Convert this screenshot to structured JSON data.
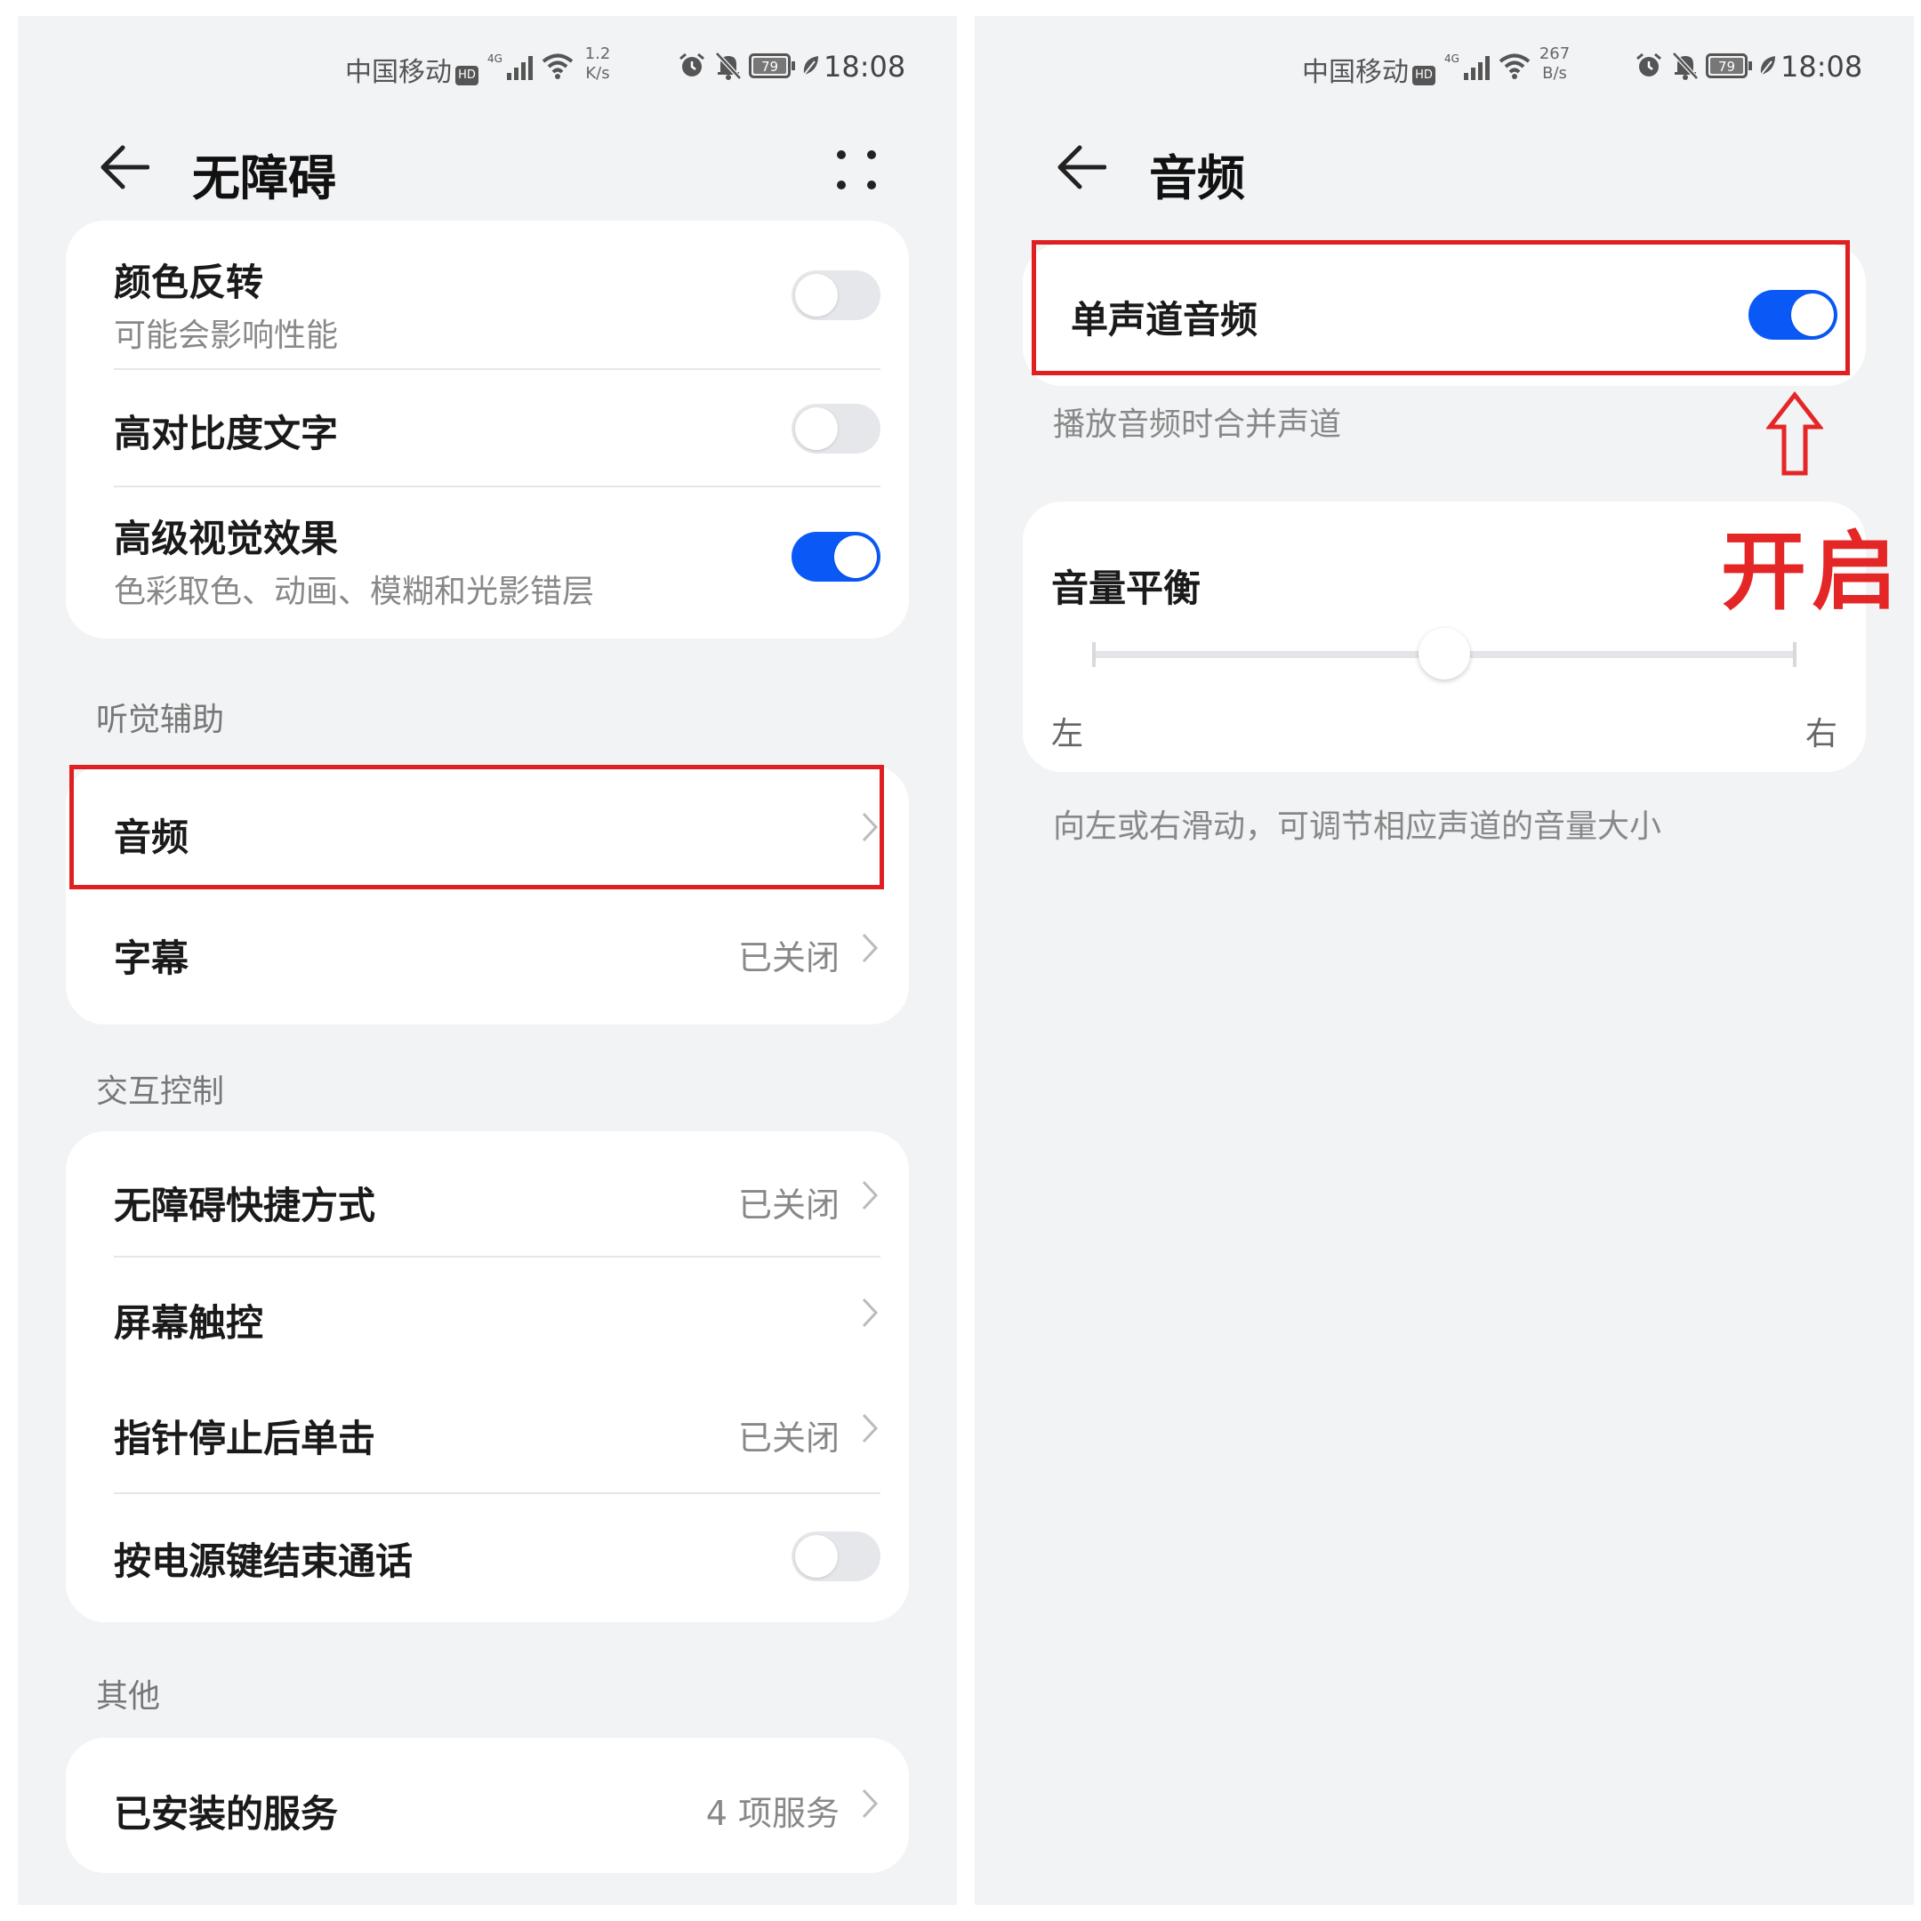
{
  "status_left": {
    "carrier": "中国移动",
    "hd": "HD",
    "net": "4G",
    "speed_top": "1.2",
    "speed_bottom": "K/s",
    "battery": "79",
    "time": "18:08"
  },
  "status_right": {
    "carrier": "中国移动",
    "hd": "HD",
    "net": "4G",
    "speed_top": "267",
    "speed_bottom": "B/s",
    "battery": "79",
    "time": "18:08"
  },
  "left": {
    "title": "无障碍",
    "display_group": [
      {
        "label": "颜色反转",
        "sub": "可能会影响性能",
        "on": false
      },
      {
        "label": "高对比度文字",
        "on": false
      },
      {
        "label": "高级视觉效果",
        "sub": "色彩取色、动画、模糊和光影错层",
        "on": true
      }
    ],
    "hearing_section": "听觉辅助",
    "hearing_items": [
      {
        "label": "音频",
        "value": ""
      },
      {
        "label": "字幕",
        "value": "已关闭"
      }
    ],
    "interaction_section": "交互控制",
    "interaction_items": [
      {
        "label": "无障碍快捷方式",
        "value": "已关闭"
      },
      {
        "label": "屏幕触控",
        "value": ""
      },
      {
        "label": "指针停止后单击",
        "value": "已关闭"
      },
      {
        "label": "按电源键结束通话",
        "on": false
      }
    ],
    "other_section": "其他",
    "other_items": [
      {
        "label": "已安装的服务",
        "value": "4 项服务"
      }
    ]
  },
  "right": {
    "title": "音频",
    "mono": {
      "label": "单声道音频",
      "on": true,
      "desc": "播放音频时合并声道"
    },
    "balance": {
      "label": "音量平衡",
      "left": "左",
      "right": "右",
      "position": 0.5
    },
    "balance_note": "向左或右滑动，可调节相应声道的音量大小"
  },
  "annotation": {
    "text": "开启",
    "color": "#e52626"
  },
  "colors": {
    "accent": "#0a59f7",
    "highlight": "#e02020"
  }
}
